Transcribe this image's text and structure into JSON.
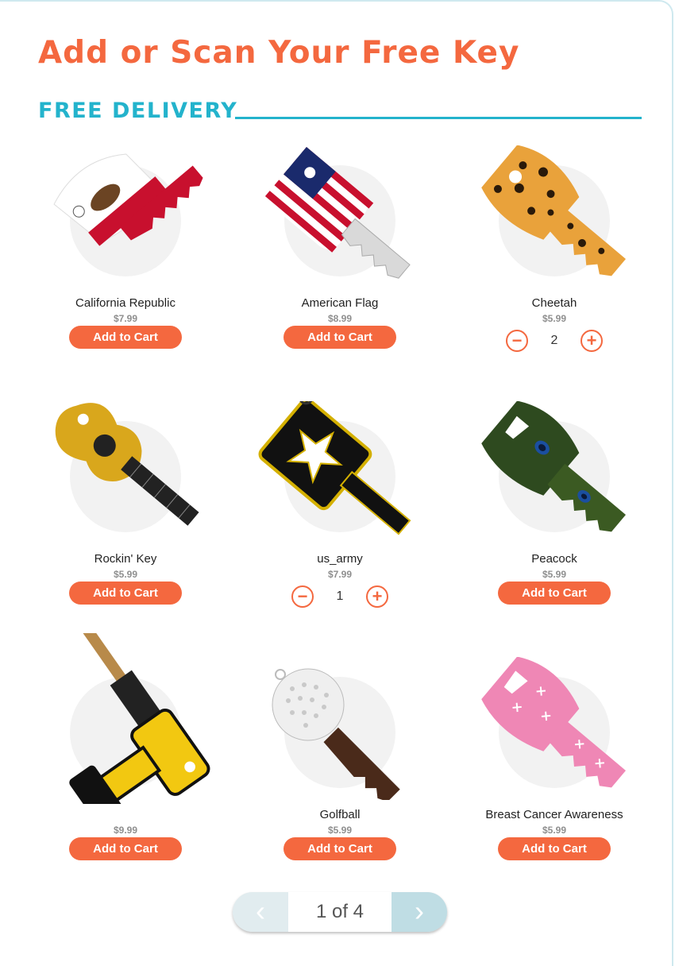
{
  "page": {
    "title": "Add or Scan Your Free Key",
    "section": "FREE DELIVERY"
  },
  "products": [
    {
      "name": "California Republic",
      "price": "$7.99",
      "action": "Add to Cart",
      "art": "california-flag-key-image"
    },
    {
      "name": "American Flag",
      "price": "$8.99",
      "action": "Add to Cart",
      "art": "american-flag-key-image"
    },
    {
      "name": "Cheetah",
      "price": "$5.99",
      "quantity": "2",
      "art": "cheetah-key-image"
    },
    {
      "name": "Rockin' Key",
      "price": "$5.99",
      "action": "Add to Cart",
      "art": "guitar-key-image"
    },
    {
      "name": "us_army",
      "price": "$7.99",
      "quantity": "1",
      "art": "us-army-key-image"
    },
    {
      "name": "Peacock",
      "price": "$5.99",
      "action": "Add to Cart",
      "art": "peacock-key-image"
    },
    {
      "name": "",
      "price": "$9.99",
      "action": "Add to Cart",
      "art": "power-drill-key-image"
    },
    {
      "name": "Golfball",
      "price": "$5.99",
      "action": "Add to Cart",
      "art": "golfball-key-image"
    },
    {
      "name": "Breast Cancer Awareness",
      "price": "$5.99",
      "action": "Add to Cart",
      "art": "pink-ribbon-key-image"
    }
  ],
  "pagination": {
    "label": "1 of 4",
    "prev_icon": "chevron-left-icon",
    "next_icon": "chevron-right-icon"
  },
  "colors": {
    "accent": "#f4683f",
    "section": "#23b3cc"
  }
}
